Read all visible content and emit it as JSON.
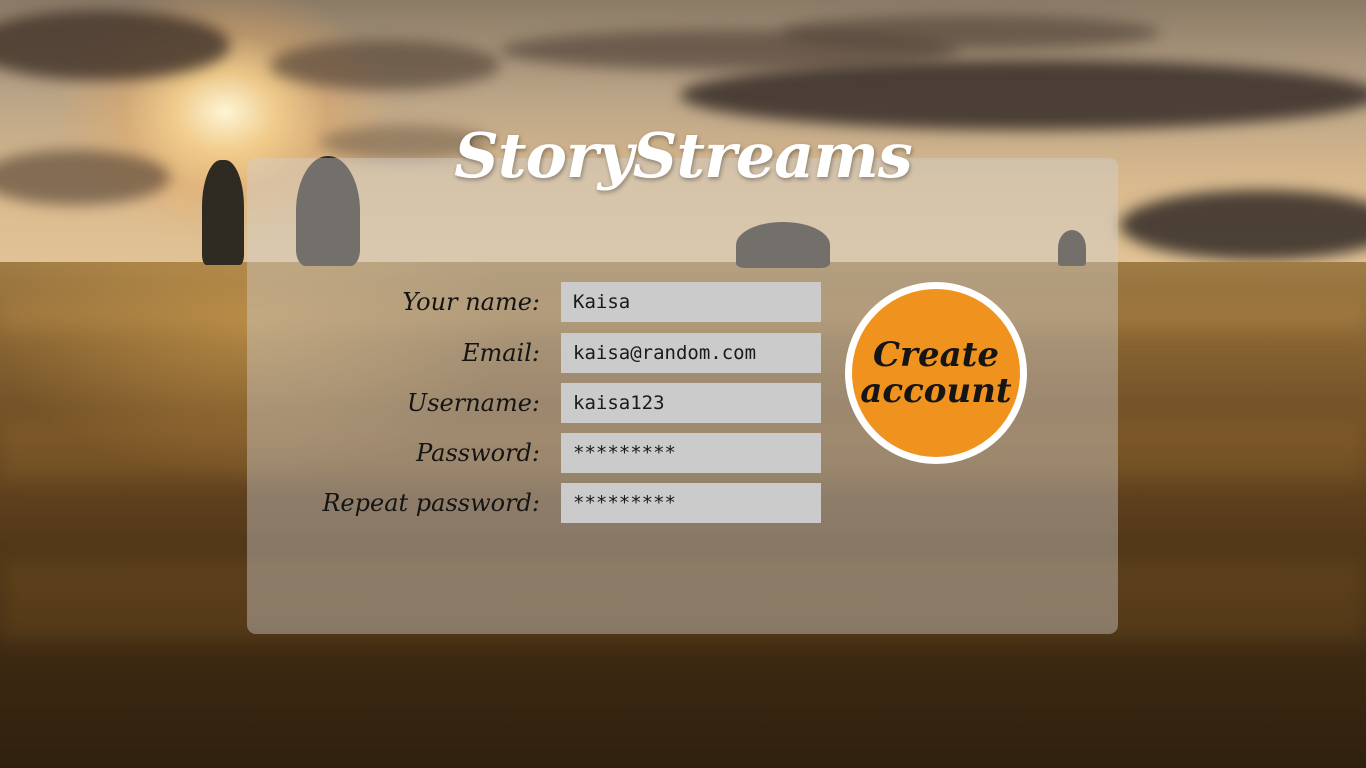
{
  "app": {
    "title": "StoryStreams"
  },
  "form": {
    "name_label": "Your name:",
    "name_value": "Kaisa",
    "email_label": "Email:",
    "email_value": "kaisa@random.com",
    "username_label": "Username:",
    "username_value": "kaisa123",
    "password_label": "Password:",
    "password_value": "*********",
    "repeat_password_label": "Repeat password:",
    "repeat_password_value": "*********"
  },
  "actions": {
    "create_account_label": "Create account"
  },
  "colors": {
    "accent": "#f0921e",
    "panel": "rgba(210,210,210,0.42)",
    "input": "#cbcbcb"
  }
}
